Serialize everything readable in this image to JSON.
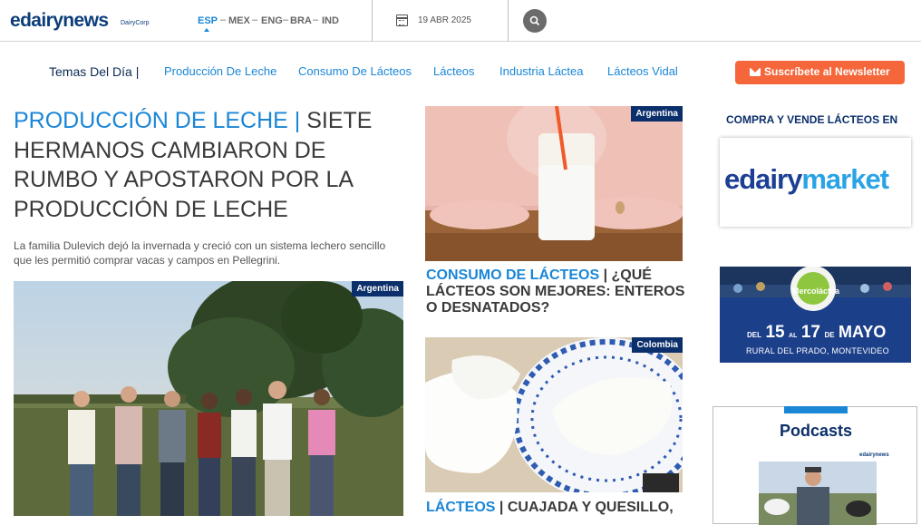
{
  "header": {
    "logo": "edairynews",
    "logo_sub": "DairyCorp",
    "languages": [
      {
        "code": "ESP",
        "active": true
      },
      {
        "code": "MEX",
        "active": false
      },
      {
        "code": "ENG",
        "active": false
      },
      {
        "code": "BRA",
        "active": false
      },
      {
        "code": "IND",
        "active": false
      }
    ],
    "date": "19 ABR 2025"
  },
  "nav": {
    "label": "Temas Del Día |",
    "items": [
      "Producción De Leche",
      "Consumo De Lácteos",
      "Lácteos",
      "Industria Láctea",
      "Lácteos Vidal"
    ],
    "newsletter": "Suscríbete al Newsletter"
  },
  "main_article": {
    "category": "PRODUCCIÓN DE LECHE |",
    "title": "SIETE HERMANOS CAMBIARON DE RUMBO Y APOSTARON POR LA PRODUCCIÓN DE LECHE",
    "summary": "La familia Dulevich dejó la invernada y creció con un sistema lechero sencillo que les permitió comprar vacas y campos en Pellegrini.",
    "tag": "Argentina"
  },
  "cards": [
    {
      "tag": "Argentina",
      "category": "CONSUMO DE LÁCTEOS",
      "title": "| ¿QUÉ LÁCTEOS SON MEJORES: ENTEROS O DESNATADOS?"
    },
    {
      "tag": "Colombia",
      "category": "LÁCTEOS",
      "title": "| CUAJADA Y QUESILLO,"
    }
  ],
  "sidebar": {
    "compra": "COMPRA Y VENDE LÁCTEOS EN",
    "market_a": "edairy",
    "market_b": "market",
    "merco": {
      "brand": "Mercoláctea",
      "date_prefix": "DEL",
      "day_start": "15",
      "al": "AL",
      "day_end": "17",
      "de": "DE",
      "month": "MAYO",
      "place": "RURAL DEL PRADO, MONTEVIDEO"
    },
    "podcasts": "Podcasts",
    "podcast_logo": "edairynews"
  },
  "colors": {
    "accent": "#1a86d6",
    "navy": "#0b2f6b",
    "newsletter": "#f5673a"
  }
}
